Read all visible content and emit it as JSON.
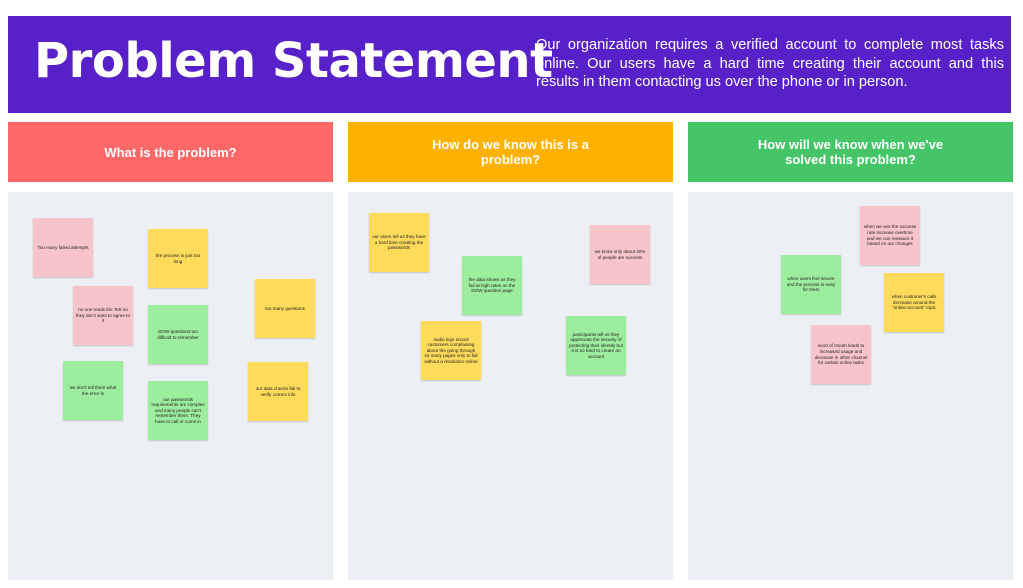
{
  "banner": {
    "title": "Problem Statement",
    "description": "Our organization requires a verified account to complete most tasks online. Our users have a hard time creating their account and this results in them contacting us over the phone or in person."
  },
  "colors": {
    "banner": "#5720c8",
    "column_1": "#fe6868",
    "column_2": "#ffb100",
    "column_3": "#45c568",
    "board": "#eceff3",
    "note_pink": "#f8c4cc",
    "note_yellow": "#fedb5a",
    "note_green": "#9ded9e"
  },
  "columns": [
    {
      "header": "What is the problem?",
      "notes": [
        {
          "text": "Too many failed attempts",
          "color": "pink"
        },
        {
          "text": "the process is just too long",
          "color": "yellow"
        },
        {
          "text": "no one reads the ToS so they don't want to agree to it",
          "color": "pink"
        },
        {
          "text": "too many questions",
          "color": "yellow"
        },
        {
          "text": "DOW questions too difficult to remember",
          "color": "green"
        },
        {
          "text": "we don't tell them what the error is",
          "color": "green"
        },
        {
          "text": "our passwords requirements are complex and many people can't remember them. They have to call or come in",
          "color": "green"
        },
        {
          "text": "our data checks fail to verify correct info",
          "color": "yellow"
        }
      ]
    },
    {
      "header": "How do we know this is a problem?",
      "notes": [
        {
          "text": "our users tell us they have a hard time creating the passwords",
          "color": "yellow"
        },
        {
          "text": "we know only about 40% of people are success",
          "color": "pink"
        },
        {
          "text": "the data shows us they fail at high rates on the DOW question page",
          "color": "green"
        },
        {
          "text": "audio logs record customers complaining about the going through so many pages only to fail without a resolution online",
          "color": "yellow"
        },
        {
          "text": "participants tell us they appreciate the security of protecting their identity but it is so hard to create an account",
          "color": "green"
        }
      ]
    },
    {
      "header": "How will we know when we've solved this problem?",
      "notes": [
        {
          "text": "when we see the success rate increase overtime and we can measure it based on our changes",
          "color": "pink"
        },
        {
          "text": "when users feel secure and the process is easy for them",
          "color": "green"
        },
        {
          "text": "when customer's calls decrease around the \"online account\" topic",
          "color": "yellow"
        },
        {
          "text": "word of mouth leads to increased usage and decrease in other channel for certain online tasks",
          "color": "pink"
        }
      ]
    }
  ]
}
